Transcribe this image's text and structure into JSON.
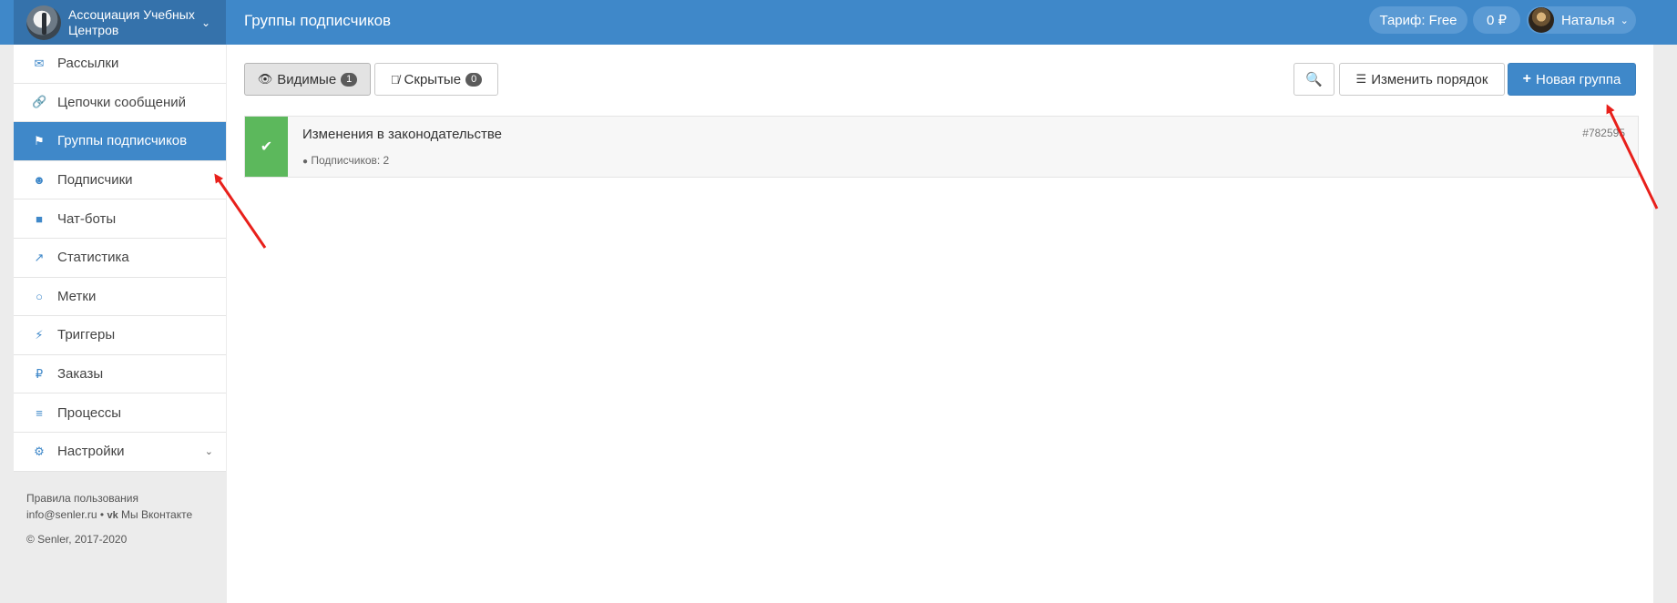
{
  "header": {
    "org_name": "Ассоциация Учебных Центров",
    "page_title": "Группы подписчиков",
    "tariff": "Тариф: Free",
    "balance": "0 ₽",
    "user_name": "Наталья"
  },
  "sidebar": {
    "items": [
      {
        "label": "Рассылки",
        "icon": "envelope-icon",
        "active": false
      },
      {
        "label": "Цепочки сообщений",
        "icon": "chain-link-icon",
        "active": false
      },
      {
        "label": "Группы подписчиков",
        "icon": "tags-icon",
        "active": true
      },
      {
        "label": "Подписчики",
        "icon": "users-icon",
        "active": false
      },
      {
        "label": "Чат-боты",
        "icon": "android-icon",
        "active": false
      },
      {
        "label": "Статистика",
        "icon": "line-chart-icon",
        "active": false
      },
      {
        "label": "Метки",
        "icon": "circle-icon",
        "active": false
      },
      {
        "label": "Триггеры",
        "icon": "bolt-icon",
        "active": false
      },
      {
        "label": "Заказы",
        "icon": "ruble-icon",
        "active": false
      },
      {
        "label": "Процессы",
        "icon": "server-icon",
        "active": false
      },
      {
        "label": "Настройки",
        "icon": "cogs-icon",
        "active": false
      }
    ],
    "footer": {
      "terms": "Правила пользования",
      "email": "info@senler.ru",
      "separator": "•",
      "vk": "Мы Вконтакте",
      "copyright": "© Senler, 2017-2020"
    }
  },
  "toolbar": {
    "visible_label": "Видимые",
    "visible_count": "1",
    "hidden_label": "Скрытые",
    "hidden_count": "0",
    "reorder_label": "Изменить порядок",
    "new_group_label": "Новая группа"
  },
  "groups": [
    {
      "name": "Изменения в законодательстве",
      "subscribers": "Подписчиков: 2",
      "id": "#782595"
    }
  ],
  "colors": {
    "brand": "#3f88c9",
    "brand_dark": "#3572ab",
    "success": "#5cb85c",
    "annotation_arrow": "#e8201b"
  }
}
